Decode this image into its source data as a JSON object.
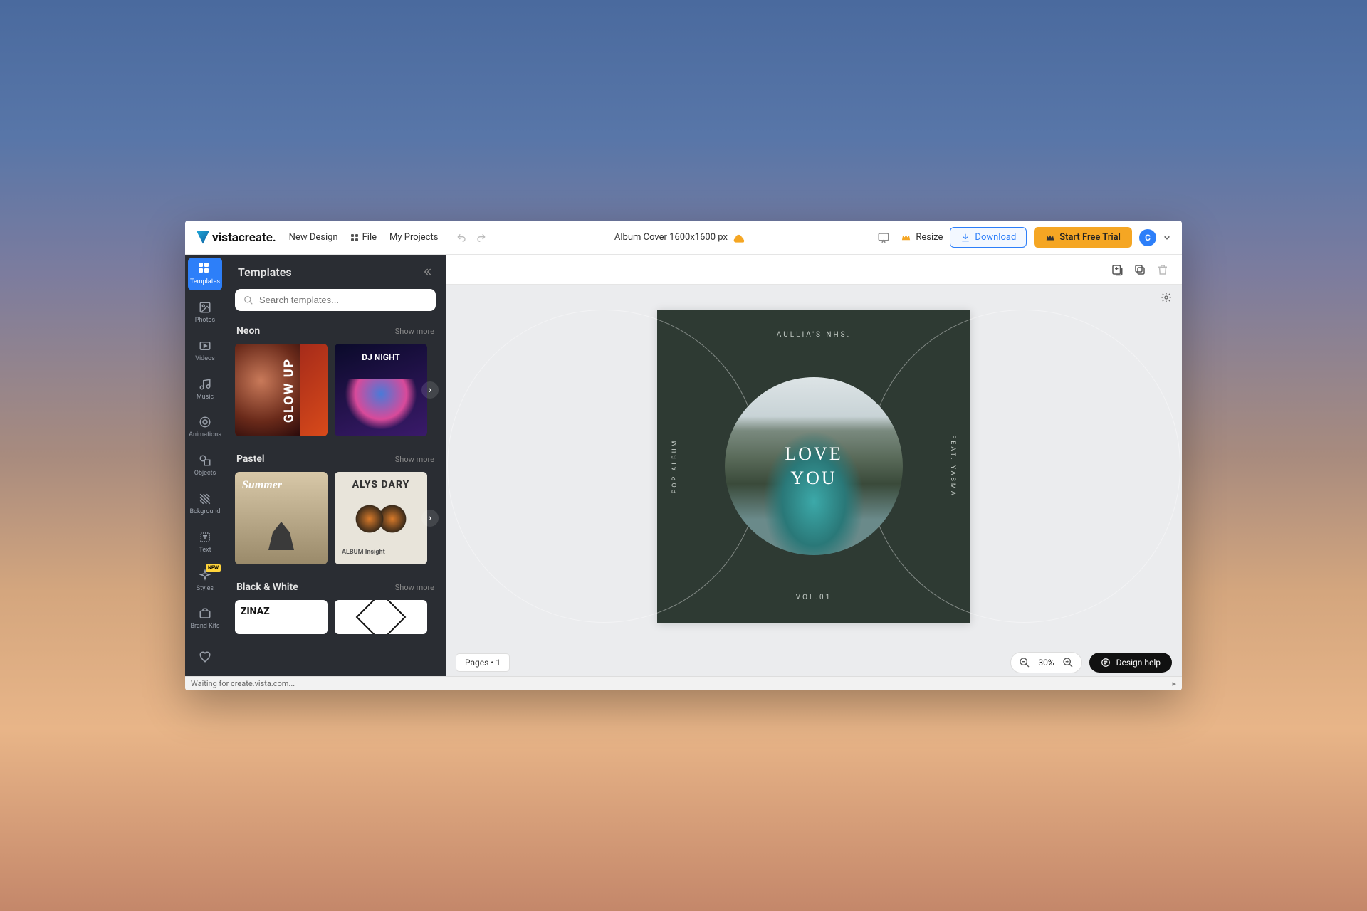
{
  "brand": {
    "name_bold": "vista",
    "name_light": "create."
  },
  "topbar": {
    "new_design": "New Design",
    "file": "File",
    "my_projects": "My Projects",
    "doc_title": "Album Cover 1600x1600 px",
    "resize": "Resize",
    "download": "Download",
    "trial": "Start Free Trial",
    "avatar_letter": "C"
  },
  "rail": {
    "templates": "Templates",
    "photos": "Photos",
    "videos": "Videos",
    "music": "Music",
    "animations": "Animations",
    "objects": "Objects",
    "bckground": "Bckground",
    "text": "Text",
    "styles": "Styles",
    "styles_badge": "NEW",
    "brand_kits": "Brand Kits"
  },
  "panel": {
    "title": "Templates",
    "search_placeholder": "Search templates...",
    "show_more": "Show more",
    "sections": {
      "neon": {
        "title": "Neon",
        "t1": "GLOW UP",
        "t2": "DJ NIGHT"
      },
      "pastel": {
        "title": "Pastel",
        "t1": "Summer",
        "t2": "ALYS DARY",
        "t2sub": "ALBUM Insight"
      },
      "bw": {
        "title": "Black & White",
        "t1": "ZINAZ"
      }
    }
  },
  "album": {
    "top": "AULLIA'S NHS.",
    "left": "POP ALBUM",
    "right": "FEAT. YASMA",
    "bottom": "VOL.01",
    "title_line1": "LOVE",
    "title_line2": "YOU"
  },
  "bottom": {
    "pages": "Pages • 1",
    "zoom": "30%",
    "design_help": "Design help"
  },
  "status": {
    "text": "Waiting for create.vista.com..."
  }
}
